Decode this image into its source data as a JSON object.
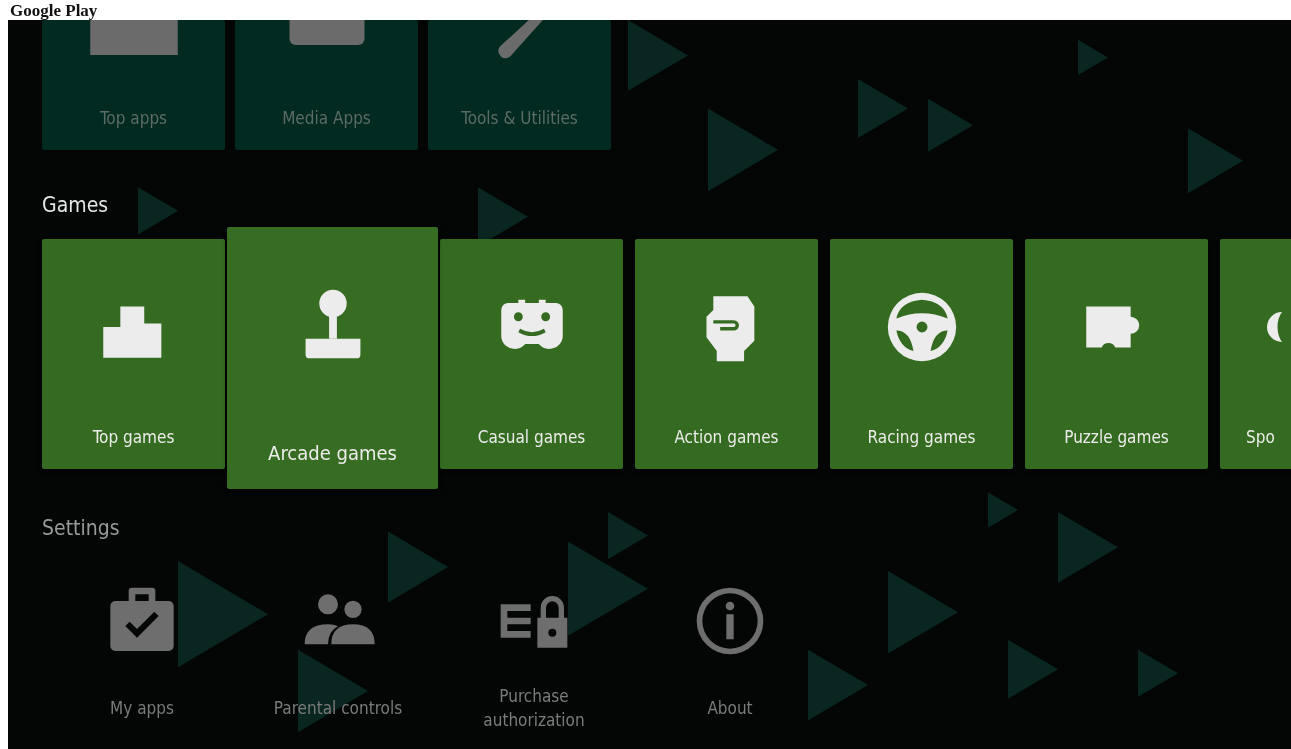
{
  "header": {
    "title": "Google Play"
  },
  "sections": [
    {
      "kind": "tiles",
      "focused": false,
      "items": [
        {
          "label": "Top apps"
        },
        {
          "label": "Media Apps"
        },
        {
          "label": "Tools & Utilities"
        }
      ]
    },
    {
      "kind": "tiles",
      "title": "Games",
      "focused": true,
      "items": [
        {
          "label": "Top games",
          "selected": false
        },
        {
          "label": "Arcade games",
          "selected": true
        },
        {
          "label": "Casual games",
          "selected": false
        },
        {
          "label": "Action games",
          "selected": false
        },
        {
          "label": "Racing games",
          "selected": false
        },
        {
          "label": "Puzzle games",
          "selected": false
        },
        {
          "label": "Spo",
          "selected": false
        }
      ]
    },
    {
      "kind": "icons",
      "title": "Settings",
      "focused": false,
      "items": [
        {
          "label": "My apps"
        },
        {
          "label": "Parental controls"
        },
        {
          "label": "Purchase authorization"
        },
        {
          "label": "About"
        }
      ]
    }
  ]
}
